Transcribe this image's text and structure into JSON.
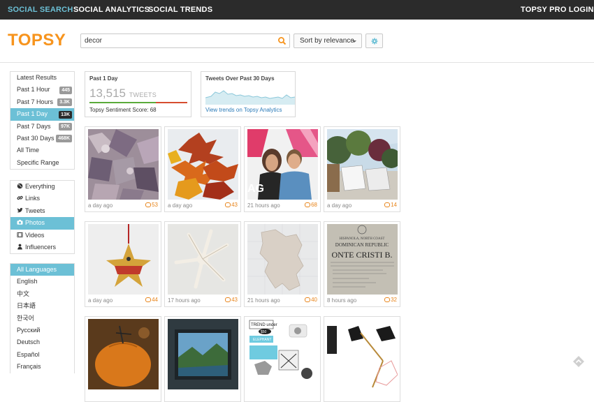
{
  "topnav": {
    "social_search": "SOCIAL SEARCH",
    "social_analytics": "SOCIAL ANALYTICS",
    "social_trends": "SOCIAL TRENDS",
    "pro_login": "TOPSY PRO LOGIN"
  },
  "header": {
    "logo": "TOPSY",
    "search_value": "decor",
    "sort_label": "Sort by relevance"
  },
  "time_filters": [
    {
      "label": "Latest Results",
      "badge": ""
    },
    {
      "label": "Past 1 Hour",
      "badge": "445"
    },
    {
      "label": "Past 7 Hours",
      "badge": "3.3K"
    },
    {
      "label": "Past 1 Day",
      "badge": "13K"
    },
    {
      "label": "Past 7 Days",
      "badge": "97K"
    },
    {
      "label": "Past 30 Days",
      "badge": "468K"
    },
    {
      "label": "All Time",
      "badge": ""
    },
    {
      "label": "Specific Range",
      "badge": ""
    }
  ],
  "type_filters": [
    {
      "label": "Everything",
      "icon": "globe-icon"
    },
    {
      "label": "Links",
      "icon": "link-icon"
    },
    {
      "label": "Tweets",
      "icon": "twitter-icon"
    },
    {
      "label": "Photos",
      "icon": "camera-icon"
    },
    {
      "label": "Videos",
      "icon": "film-icon"
    },
    {
      "label": "Influencers",
      "icon": "person-icon"
    }
  ],
  "language_filters": [
    {
      "label": "All Languages"
    },
    {
      "label": "English"
    },
    {
      "label": "中文"
    },
    {
      "label": "日本語"
    },
    {
      "label": "한국어"
    },
    {
      "label": "Русский"
    },
    {
      "label": "Deutsch"
    },
    {
      "label": "Español"
    },
    {
      "label": "Français"
    }
  ],
  "summary_card": {
    "title": "Past 1 Day",
    "count": "13,515",
    "unit": "TWEETS",
    "sentiment_label": "Topsy Sentiment Score: 68",
    "sentiment_score": 68
  },
  "trend_card": {
    "title": "Tweets Over Past 30 Days",
    "link": "View trends on Topsy Analytics"
  },
  "results": [
    {
      "age": "a day ago",
      "count": "53"
    },
    {
      "age": "a day ago",
      "count": "43"
    },
    {
      "age": "21 hours ago",
      "count": "68"
    },
    {
      "age": "a day ago",
      "count": "14"
    },
    {
      "age": "a day ago",
      "count": "44"
    },
    {
      "age": "17 hours ago",
      "count": "43"
    },
    {
      "age": "21 hours ago",
      "count": "40"
    },
    {
      "age": "8 hours ago",
      "count": "32"
    },
    {
      "age": "",
      "count": ""
    },
    {
      "age": "",
      "count": ""
    },
    {
      "age": "",
      "count": ""
    },
    {
      "age": "",
      "count": ""
    }
  ],
  "image_texts": {
    "map_title1": "HISPANOLA, NORTH COAST",
    "map_title2": "DOMINICAN REPUBLIC",
    "map_title3": "ONTE CRISTI B.",
    "trend_title": "TREND under",
    "trend_price": "$50",
    "trend_item": "ELEPHANT",
    "poster_text": "AG"
  },
  "colors": {
    "accent": "#6cc0d6",
    "brand": "#f7941d",
    "topbar": "#2b2b2b",
    "comment": "#e8841a"
  }
}
